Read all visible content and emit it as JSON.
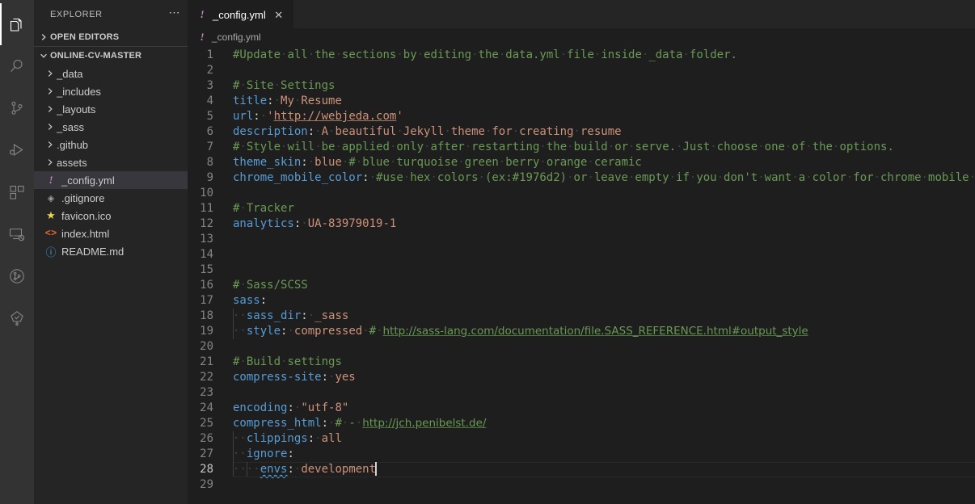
{
  "window": {
    "background": "#1e1e1e",
    "accent": "#569cd6"
  },
  "activitybar": {
    "items": [
      {
        "name": "explorer",
        "icon": "files-icon",
        "active": true
      },
      {
        "name": "search",
        "icon": "search-icon",
        "active": false
      },
      {
        "name": "source-control",
        "icon": "source-control-icon",
        "active": false
      },
      {
        "name": "run-and-debug",
        "icon": "run-debug-icon",
        "active": false
      },
      {
        "name": "extensions",
        "icon": "extensions-icon",
        "active": false
      },
      {
        "name": "remote-explorer",
        "icon": "remote-explorer-icon",
        "active": false
      },
      {
        "name": "gitlens",
        "icon": "gitlens-icon",
        "active": false
      },
      {
        "name": "live-share",
        "icon": "tree-check-icon",
        "active": false
      }
    ]
  },
  "sidebar": {
    "title": "EXPLORER",
    "ellipsis": "⋯",
    "sections": [
      {
        "label": "OPEN EDITORS",
        "expanded": false
      },
      {
        "label": "ONLINE-CV-MASTER",
        "expanded": true
      }
    ],
    "folders": [
      {
        "label": "_data"
      },
      {
        "label": "_includes"
      },
      {
        "label": "_layouts"
      },
      {
        "label": "_sass"
      },
      {
        "label": ".github"
      },
      {
        "label": "assets"
      }
    ],
    "files": [
      {
        "label": "_config.yml",
        "icon": "yml-icon",
        "glyph": "!",
        "selected": true
      },
      {
        "label": ".gitignore",
        "icon": "git-icon",
        "glyph": "◈",
        "selected": false
      },
      {
        "label": "favicon.ico",
        "icon": "star-icon",
        "glyph": "★",
        "selected": false
      },
      {
        "label": "index.html",
        "icon": "html-icon",
        "glyph": "<>",
        "selected": false
      },
      {
        "label": "README.md",
        "icon": "info-icon",
        "glyph": "ⓘ",
        "selected": false
      }
    ]
  },
  "editor": {
    "tab": {
      "label": "_config.yml",
      "glyph": "!",
      "close": "✕"
    },
    "breadcrumb": {
      "label": "_config.yml",
      "glyph": "!"
    },
    "cursor_line": 28,
    "total_lines": 29,
    "code_lines": [
      {
        "n": 1,
        "text": "#Update all the sections by editing the data.yml file inside _data folder."
      },
      {
        "n": 2,
        "text": ""
      },
      {
        "n": 3,
        "text": "# Site Settings"
      },
      {
        "n": 4,
        "text": "title: My Resume"
      },
      {
        "n": 5,
        "text": "url: 'http://webjeda.com'"
      },
      {
        "n": 6,
        "text": "description: A beautiful Jekyll theme for creating resume"
      },
      {
        "n": 7,
        "text": "# Style will be applied only after restarting the build or serve. Just choose one of the options."
      },
      {
        "n": 8,
        "text": "theme_skin: blue # blue turquoise green berry orange ceramic"
      },
      {
        "n": 9,
        "text": "chrome_mobile_color: #use hex colors (ex:#1976d2) or leave empty if you don't want a color for chrome mobile searchbar"
      },
      {
        "n": 10,
        "text": ""
      },
      {
        "n": 11,
        "text": "# Tracker"
      },
      {
        "n": 12,
        "text": "analytics: UA-83979019-1"
      },
      {
        "n": 13,
        "text": ""
      },
      {
        "n": 14,
        "text": ""
      },
      {
        "n": 15,
        "text": ""
      },
      {
        "n": 16,
        "text": "# Sass/SCSS"
      },
      {
        "n": 17,
        "text": "sass:"
      },
      {
        "n": 18,
        "text": "  sass_dir: _sass"
      },
      {
        "n": 19,
        "text": "  style: compressed # http://sass-lang.com/documentation/file.SASS_REFERENCE.html#output_style"
      },
      {
        "n": 20,
        "text": ""
      },
      {
        "n": 21,
        "text": "# Build settings"
      },
      {
        "n": 22,
        "text": "compress-site: yes"
      },
      {
        "n": 23,
        "text": ""
      },
      {
        "n": 24,
        "text": "encoding: \"utf-8\""
      },
      {
        "n": 25,
        "text": "compress_html: # - http://jch.penibelst.de/"
      },
      {
        "n": 26,
        "text": "  clippings: all"
      },
      {
        "n": 27,
        "text": "  ignore:"
      },
      {
        "n": 28,
        "text": "    envs: development"
      },
      {
        "n": 29,
        "text": ""
      }
    ],
    "colors": {
      "comment": "#6a9955",
      "key": "#569cd6",
      "value": "#ce9178",
      "punctuation": "#d4d4d4",
      "whitespace_dot": "#3f4142",
      "link_underline": "#4a7a3a",
      "spellcheck_squiggle": "#4e9ad4",
      "line_number": "#858585",
      "line_number_active": "#c6c6c6",
      "indent_guide": "#404040"
    }
  }
}
